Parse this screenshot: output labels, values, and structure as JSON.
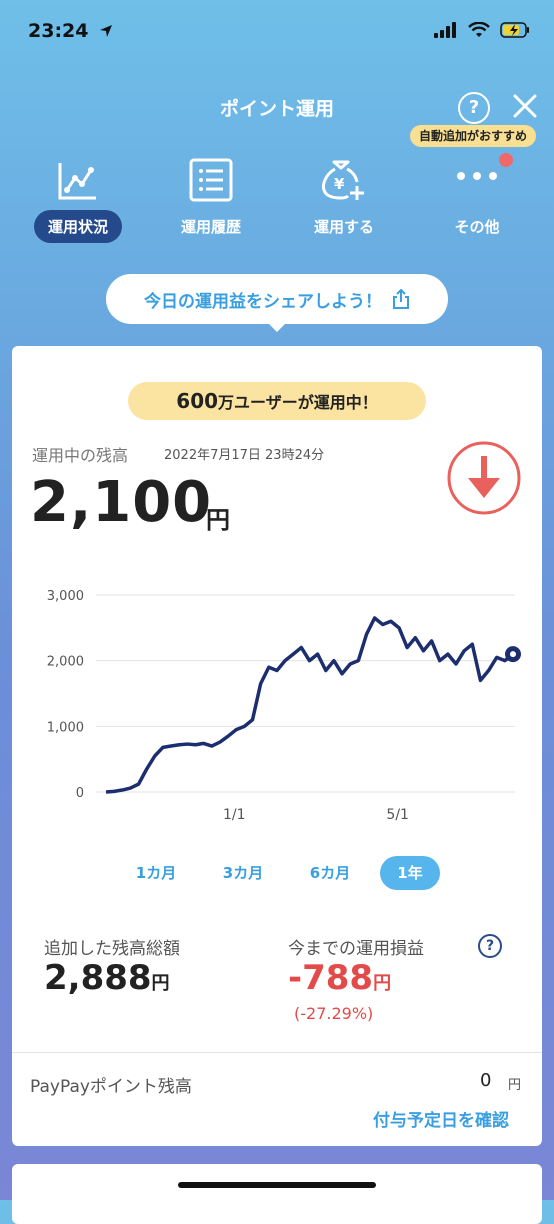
{
  "status": {
    "time": "23:24"
  },
  "header": {
    "title": "ポイント運用",
    "help": "?",
    "recommend_badge": "自動追加がおすすめ"
  },
  "tabs": [
    {
      "label": "運用状況",
      "icon": "line-chart-icon",
      "active": true
    },
    {
      "label": "運用履歴",
      "icon": "list-icon",
      "active": false
    },
    {
      "label": "運用する",
      "icon": "money-bag-add-icon",
      "active": false
    },
    {
      "label": "その他",
      "icon": "more-dots-icon",
      "active": false
    }
  ],
  "share": {
    "label": "今日の運用益をシェアしよう！"
  },
  "badge": {
    "number": "600",
    "text": "万ユーザーが運用中！"
  },
  "balance": {
    "label": "運用中の残高",
    "date": "2022年7月17日 23時24分",
    "value": "2,100",
    "unit": "円"
  },
  "chart_data": {
    "type": "line",
    "y_ticks": [
      "3,000",
      "2,000",
      "1,000",
      "0"
    ],
    "ylim": [
      0,
      3000
    ],
    "x_tick_labels": [
      "1/1",
      "5/1"
    ],
    "grid": true,
    "series": [
      {
        "values": [
          0,
          10,
          30,
          60,
          120,
          350,
          550,
          680,
          700,
          720,
          730,
          720,
          740,
          700,
          760,
          850,
          950,
          1000,
          1100,
          1650,
          1900,
          1850,
          2000,
          2100,
          2200,
          2000,
          2100,
          1850,
          2000,
          1800,
          1950,
          2000,
          2400,
          2650,
          2550,
          2600,
          2500,
          2200,
          2350,
          2150,
          2300,
          2000,
          2100,
          1950,
          2150,
          2250,
          1700,
          1850,
          2050,
          2000,
          2100
        ]
      }
    ],
    "color": "#1d2e6e"
  },
  "periods": [
    {
      "label": "1カ月",
      "active": false
    },
    {
      "label": "3カ月",
      "active": false
    },
    {
      "label": "6カ月",
      "active": false
    },
    {
      "label": "1年",
      "active": true
    }
  ],
  "totals": {
    "added_label": "追加した残高総額",
    "added_value": "2,888",
    "pl_label": "今までの運用損益",
    "pl_value": "-788",
    "pl_pct": "(-27.29%)",
    "unit": "円",
    "help": "?"
  },
  "paypay": {
    "label": "PayPayポイント残高",
    "value": "0",
    "unit": "円",
    "link": "付与予定日を確認"
  },
  "colors": {
    "accent_blue": "#3a9fe0",
    "navy": "#254a8c",
    "loss_red": "#e34a4a",
    "badge_yellow": "#fbe3a1"
  }
}
